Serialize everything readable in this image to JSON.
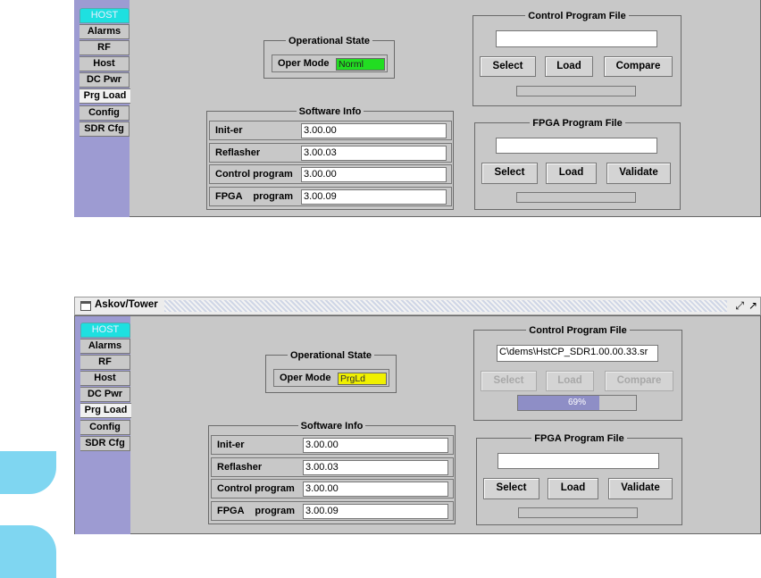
{
  "panels": {
    "top": {
      "tabs": [
        "HOST",
        "Alarms",
        "RF",
        "Host",
        "DC Pwr",
        "Prg Load",
        "Config",
        "SDR Cfg"
      ],
      "operational_state": {
        "title": "Operational State",
        "label": "Oper Mode",
        "value": "Norml",
        "color": "#22dd22"
      },
      "software_info": {
        "title": "Software Info",
        "rows": [
          {
            "label": "Init-er",
            "value": "3.00.00"
          },
          {
            "label": "Reflasher",
            "value": "3.00.03"
          },
          {
            "label": "Control program",
            "value": "3.00.00"
          },
          {
            "label": "FPGA    program",
            "value": "3.00.09"
          }
        ]
      },
      "control_program_file": {
        "title": "Control Program File",
        "path": "",
        "buttons": [
          "Select",
          "Load",
          "Compare"
        ],
        "progress": 0,
        "progress_text": ""
      },
      "fpga_program_file": {
        "title": "FPGA Program File",
        "path": "",
        "buttons": [
          "Select",
          "Load",
          "Validate"
        ],
        "progress": 0
      }
    },
    "bottom": {
      "window_title": "Askov/Tower",
      "window_controls": [
        "restore-icon",
        "maximize-icon"
      ],
      "tabs": [
        "HOST",
        "Alarms",
        "RF",
        "Host",
        "DC Pwr",
        "Prg Load",
        "Config",
        "SDR Cfg"
      ],
      "operational_state": {
        "title": "Operational State",
        "label": "Oper Mode",
        "value": "PrgLd",
        "color": "#f0f000"
      },
      "software_info": {
        "title": "Software Info",
        "rows": [
          {
            "label": "Init-er",
            "value": "3.00.00"
          },
          {
            "label": "Reflasher",
            "value": "3.00.03"
          },
          {
            "label": "Control program",
            "value": "3.00.00"
          },
          {
            "label": "FPGA    program",
            "value": "3.00.09"
          }
        ]
      },
      "control_program_file": {
        "title": "Control Program File",
        "path": "C\\dems\\HstCP_SDR1.00.00.33.sr",
        "buttons": [
          "Select",
          "Load",
          "Compare"
        ],
        "buttons_disabled": true,
        "progress": 0.69,
        "progress_text": "69%"
      },
      "fpga_program_file": {
        "title": "FPGA Program File",
        "path": "",
        "buttons": [
          "Select",
          "Load",
          "Validate"
        ],
        "progress": 0
      }
    }
  },
  "colors": {
    "sidebar": "#9d9bd2",
    "panel_bg": "#c8c8c8",
    "host_tab": "#1ee0e0",
    "progress_fill": "#8e8ec6",
    "side_decoration": "#7fd6f1"
  }
}
